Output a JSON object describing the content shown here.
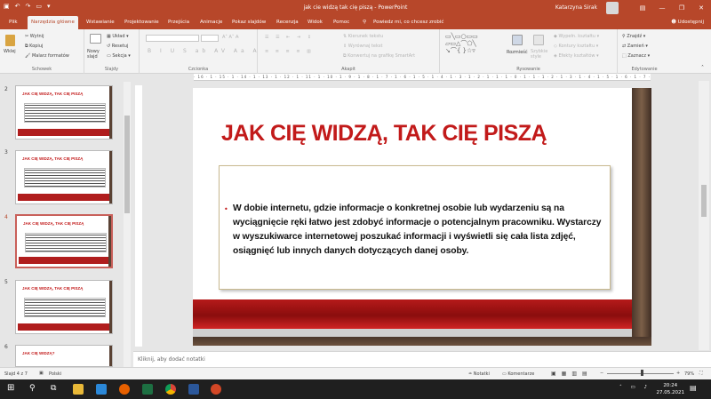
{
  "titlebar": {
    "title": "jak cie widzą tak cię piszą  -  PowerPoint",
    "user": "Katarzyna Sirak",
    "minimize": "—",
    "restore": "❐",
    "close": "✕"
  },
  "tabs": {
    "file": "Plik",
    "home": "Narzędzia główne",
    "insert": "Wstawianie",
    "design": "Projektowanie",
    "transitions": "Przejścia",
    "animations": "Animacje",
    "slideshow": "Pokaz slajdów",
    "review": "Recenzja",
    "view": "Widok",
    "help": "Pomoc",
    "tellme": "Powiedz mi, co chcesz zrobić",
    "share": "Udostępnij"
  },
  "ribbon": {
    "paste": "Wklej",
    "cut": "Wytnij",
    "copy": "Kopiuj",
    "format_painter": "Malarz formatów",
    "clipboard": "Schowek",
    "new_slide": "Nowy slajd",
    "layout": "Układ",
    "reset": "Resetuj",
    "section": "Sekcja",
    "slides": "Slajdy",
    "font": "Czcionka",
    "text_direction": "Kierunek tekstu",
    "align_text": "Wyrównaj tekst",
    "convert_smartart": "Konwertuj na grafikę SmartArt",
    "paragraph": "Akapit",
    "arrange": "Rozmieść",
    "quick_styles": "Szybkie style",
    "shape_fill": "Wypełn. kształtu",
    "shape_outline": "Kontury kształtu",
    "shape_effects": "Efekty kształtów",
    "drawing": "Rysowanie",
    "find": "Znajdź",
    "replace": "Zamień",
    "select": "Zaznacz",
    "editing": "Edytowanie"
  },
  "ruler": "· 16 · 1 · 15 · 1 · 14 · 1 · 13 · 1 · 12 · 1 · 11 · 1 · 10 · 1 · 9 · 1 · 8 · 1 · 7 · 1 · 6 · 1 · 5 · 1 · 4 · 1 · 3 · 1 · 2 · 1 · 1 · 1 · 0 · 1 · 1 · 1 · 2 · 1 · 3 · 1 · 4 · 1 · 5 · 1 · 6 · 1 · 7 · 1 · 8 · 1 · 9 · 1 · 10 · 1 · 11 · 1 · 12 · 1 · 13 · 1 · 14 · 1 · 15 · 1 · 16 ·",
  "thumbnails": [
    {
      "num": "2",
      "title": "JAK CIĘ WIDZĄ, TAK CIĘ PISZĄ"
    },
    {
      "num": "3",
      "title": "JAK CIĘ WIDZĄ, TAK CIĘ PISZĄ"
    },
    {
      "num": "4",
      "title": "JAK CIĘ WIDZĄ, TAK CIĘ PISZĄ"
    },
    {
      "num": "5",
      "title": "JAK CIĘ WIDZĄ, TAK CIĘ PISZĄ"
    },
    {
      "num": "6",
      "title": "JAK CIĘ WIDZĄ?"
    }
  ],
  "slide": {
    "title": "JAK CIĘ WIDZĄ, TAK CIĘ PISZĄ",
    "bullet": "•",
    "body": "W dobie internetu, gdzie informacje o konkretnej osobie lub wydarzeniu są na wyciągnięcie ręki łatwo jest zdobyć informacje o potencjalnym pracowniku. Wystarczy w wyszukiwarce internetowej poszukać informacji i wyświetli się cała lista zdjęć, osiągnięć lub innych danych dotyczących danej osoby."
  },
  "notes_placeholder": "Kliknij, aby dodać notatki",
  "status": {
    "slide_of": "Slajd 4 z 7",
    "language": "Polski",
    "notes": "Notatki",
    "comments": "Komentarze",
    "zoom": "79%"
  },
  "taskbar": {
    "time": "20:24",
    "date": "27.05.2021"
  },
  "colors": {
    "brand": "#b7472a",
    "title_red": "#c21a1a"
  }
}
